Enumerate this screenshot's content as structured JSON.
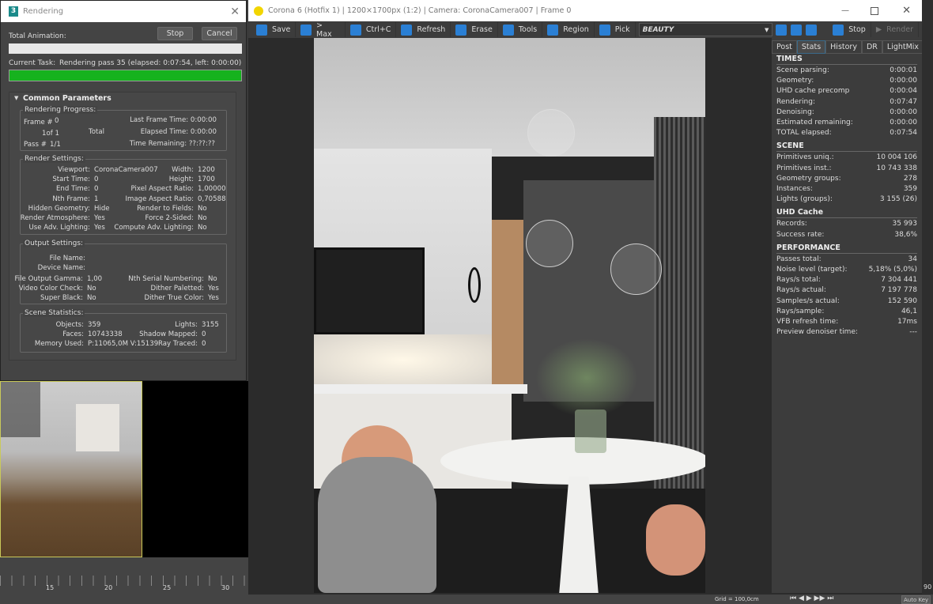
{
  "rendering_dialog": {
    "title": "Rendering",
    "app_icon": "3",
    "total_animation_label": "Total Animation:",
    "stop": "Stop",
    "cancel": "Cancel",
    "current_task_label": "Current Task:",
    "current_task": "Rendering pass 35 (elapsed: 0:07:54, left: 0:00:00)",
    "total_progress": 0,
    "task_progress": 100,
    "progress_color": "#16b21e",
    "common_parameters": "Common Parameters",
    "rendering_progress": {
      "title": "Rendering Progress:",
      "frame_label": "Frame #",
      "frame": "0",
      "of": "1of  1",
      "total": "Total",
      "pass_label": "Pass #",
      "pass": "1/1",
      "last_frame_time": "Last Frame Time:  0:00:00",
      "elapsed_time": "Elapsed Time:  0:00:00",
      "time_remaining": "Time Remaining: ??:??:??"
    },
    "render_settings": {
      "title": "Render Settings:",
      "left": [
        [
          "Viewport:",
          "CoronaCamera007"
        ],
        [
          "Start Time:",
          "0"
        ],
        [
          "End Time:",
          "0"
        ],
        [
          "Nth Frame:",
          "1"
        ],
        [
          "Hidden Geometry:",
          "Hide"
        ],
        [
          "Render Atmosphere:",
          "Yes"
        ],
        [
          "Use Adv. Lighting:",
          "Yes"
        ]
      ],
      "right": [
        [
          "Width:",
          "1200"
        ],
        [
          "Height:",
          "1700"
        ],
        [
          "Pixel Aspect Ratio:",
          "1,00000"
        ],
        [
          "Image Aspect Ratio:",
          "0,70588"
        ],
        [
          "Render to Fields:",
          "No"
        ],
        [
          "Force 2-Sided:",
          "No"
        ],
        [
          "Compute Adv. Lighting:",
          "No"
        ]
      ]
    },
    "output_settings": {
      "title": "Output Settings:",
      "file_name": "File Name:",
      "device_name": "Device Name:",
      "left": [
        [
          "File Output Gamma:",
          "1,00"
        ],
        [
          "Video Color Check:",
          "No"
        ],
        [
          "Super Black:",
          "No"
        ]
      ],
      "right": [
        [
          "Nth Serial Numbering:",
          "No"
        ],
        [
          "Dither Paletted:",
          "Yes"
        ],
        [
          "Dither True Color:",
          "Yes"
        ]
      ]
    },
    "scene_statistics": {
      "title": "Scene Statistics:",
      "left": [
        [
          "Objects:",
          "359"
        ],
        [
          "Faces:",
          "10743338"
        ],
        [
          "Memory Used:",
          "P:11065,0M V:15139"
        ]
      ],
      "right": [
        [
          "Lights:",
          "3155"
        ],
        [
          "Shadow Mapped:",
          "0"
        ],
        [
          "Ray Traced:",
          "0"
        ]
      ]
    }
  },
  "vfb": {
    "title": "Corona 6 (Hotfix 1) | 1200×1700px (1:2) | Camera: CoronaCamera007 | Frame 0",
    "toolbar": [
      {
        "label": "Save",
        "icon": "save-icon"
      },
      {
        "label": "> Max",
        "icon": "max-icon"
      },
      {
        "label": "Ctrl+C",
        "icon": "copy-icon"
      },
      {
        "label": "Refresh",
        "icon": "refresh-icon"
      },
      {
        "label": "Erase",
        "icon": "erase-icon"
      },
      {
        "label": "Tools",
        "icon": "gear-icon"
      },
      {
        "label": "Region",
        "icon": "region-icon"
      },
      {
        "label": "Pick",
        "icon": "pick-icon"
      }
    ],
    "channel": "BEAUTY",
    "stop": "Stop",
    "render": "Render",
    "tabs": [
      "Post",
      "Stats",
      "History",
      "DR",
      "LightMix"
    ],
    "active_tab": "Stats",
    "stats": [
      {
        "title": "TIMES",
        "rows": [
          [
            "Scene parsing:",
            "0:00:01"
          ],
          [
            "Geometry:",
            "0:00:00"
          ],
          [
            "UHD cache precomp",
            "0:00:04"
          ],
          [
            "Rendering:",
            "0:07:47"
          ],
          [
            "Denoising:",
            "0:00:00"
          ],
          [
            "Estimated remaining:",
            "0:00:00"
          ],
          [
            "TOTAL elapsed:",
            "0:07:54"
          ]
        ]
      },
      {
        "title": "SCENE",
        "rows": [
          [
            "Primitives uniq.:",
            "10 004 106"
          ],
          [
            "Primitives inst.:",
            "10 743 338"
          ],
          [
            "Geometry groups:",
            "278"
          ],
          [
            "Instances:",
            "359"
          ],
          [
            "Lights (groups):",
            "3 155 (26)"
          ]
        ]
      },
      {
        "title": "UHD Cache",
        "rows": [
          [
            "Records:",
            "35 993"
          ],
          [
            "Success rate:",
            "38,6%"
          ]
        ]
      },
      {
        "title": "PERFORMANCE",
        "rows": [
          [
            "Passes total:",
            "34"
          ],
          [
            "Noise level (target):",
            "5,18% (5,0%)"
          ],
          [
            "Rays/s total:",
            "7 304 441"
          ],
          [
            "Rays/s actual:",
            "7 197 778"
          ],
          [
            "Samples/s actual:",
            "152 590"
          ],
          [
            "Rays/sample:",
            "46,1"
          ],
          [
            "VFB refresh time:",
            "17ms"
          ],
          [
            "Preview denoiser time:",
            "---"
          ]
        ]
      }
    ]
  },
  "timeline": {
    "ticks": [
      "15",
      "20",
      "25",
      "30"
    ],
    "end": "90",
    "grid": "Grid = 100,0cm",
    "auto_key": "Auto Key"
  }
}
